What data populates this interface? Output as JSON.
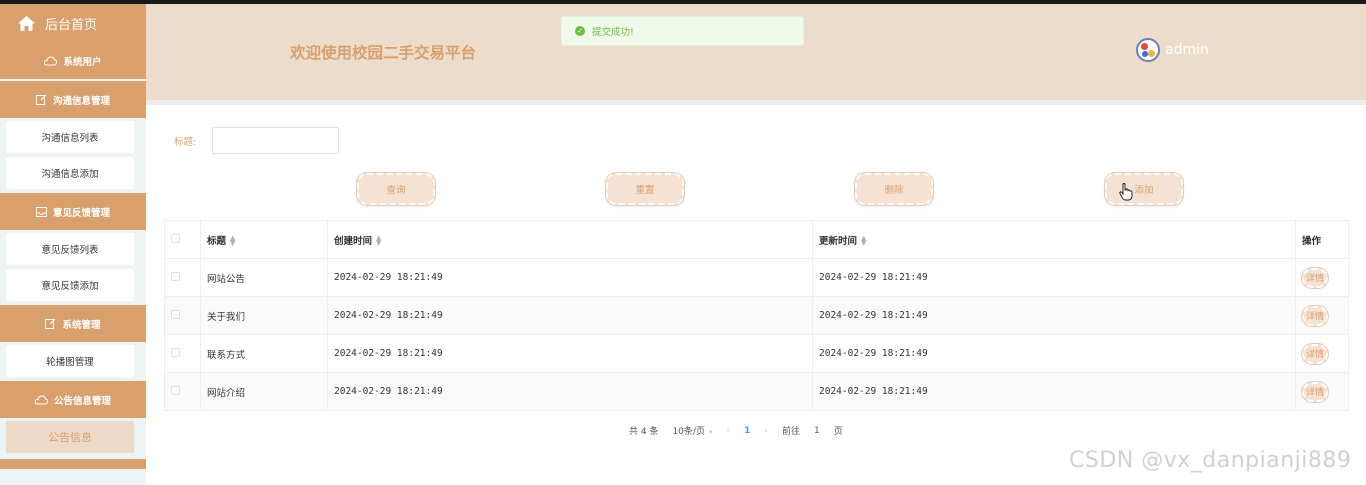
{
  "sidebar": {
    "home": {
      "label": "后台首页",
      "icon": "house-icon"
    },
    "sections": [
      {
        "label": "系统用户",
        "icon": "cloud-icon",
        "items": []
      },
      {
        "label": "沟通信息管理",
        "icon": "edit-icon",
        "items": [
          {
            "label": "沟通信息列表"
          },
          {
            "label": "沟通信息添加"
          }
        ]
      },
      {
        "label": "意见反馈管理",
        "icon": "inbox-icon",
        "items": [
          {
            "label": "意见反馈列表"
          },
          {
            "label": "意见反馈添加"
          }
        ]
      },
      {
        "label": "系统管理",
        "icon": "edit-icon",
        "items": [
          {
            "label": "轮播图管理"
          }
        ]
      },
      {
        "label": "公告信息管理",
        "icon": "cloud-icon",
        "items": [
          {
            "label": "公告信息",
            "active": true
          }
        ]
      }
    ]
  },
  "header": {
    "title": "欢迎使用校园二手交易平台",
    "user": "admin"
  },
  "toast": {
    "message": "提交成功!",
    "type": "success"
  },
  "search": {
    "label": "标题:",
    "value": "",
    "placeholder": ""
  },
  "actions": {
    "query": "查询",
    "reset": "重置",
    "delete": "删除",
    "add": "添加"
  },
  "table": {
    "columns": [
      "标题",
      "创建时间",
      "更新时间",
      "操作"
    ],
    "rows": [
      {
        "title": "网站公告",
        "created": "2024-02-29 18:21:49",
        "updated": "2024-02-29 18:21:49",
        "action": "详情"
      },
      {
        "title": "关于我们",
        "created": "2024-02-29 18:21:49",
        "updated": "2024-02-29 18:21:49",
        "action": "详情"
      },
      {
        "title": "联系方式",
        "created": "2024-02-29 18:21:49",
        "updated": "2024-02-29 18:21:49",
        "action": "详情"
      },
      {
        "title": "网站介绍",
        "created": "2024-02-29 18:21:49",
        "updated": "2024-02-29 18:21:49",
        "action": "详情"
      }
    ]
  },
  "pagination": {
    "total": "共 4 条",
    "page_size": "10条/页",
    "current": "1",
    "goto_label": "前往",
    "goto_value": "1",
    "page_suffix": "页"
  },
  "watermark": "CSDN @vx_danpianji889",
  "colors": {
    "accent": "#d99f6c",
    "header_bg": "#ecdccb",
    "success": "#67c23a",
    "page_link": "#409eff"
  }
}
